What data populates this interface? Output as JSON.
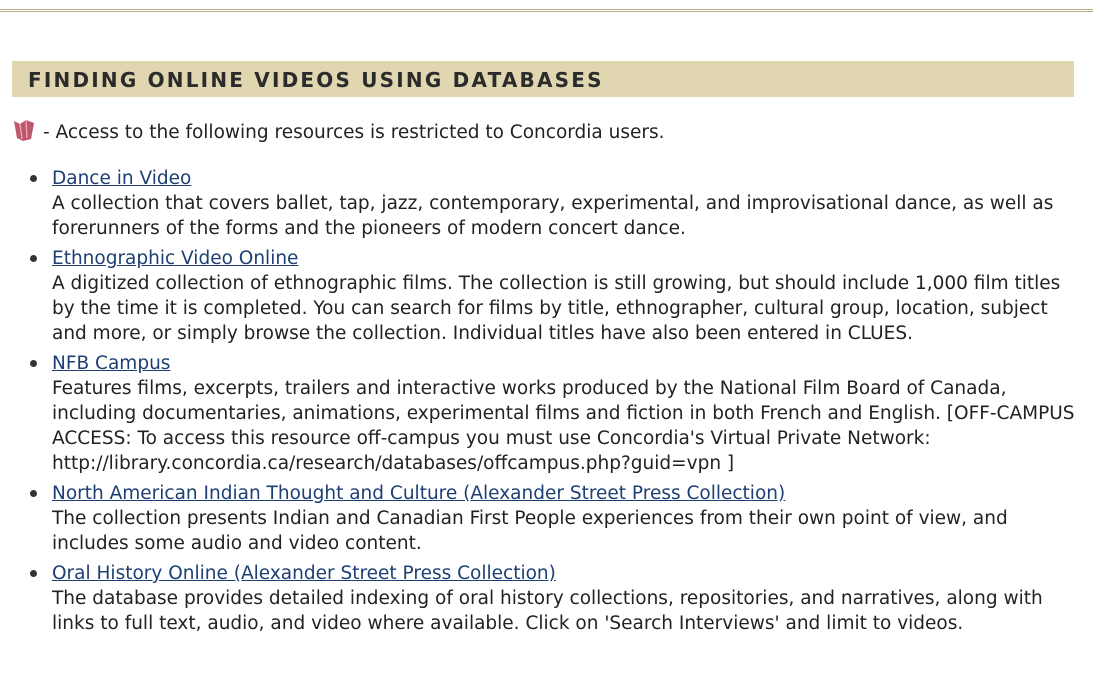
{
  "section": {
    "title": "FINDING ONLINE VIDEOS USING DATABASES"
  },
  "restricted_note": {
    "icon": "restricted-access-icon",
    "text": "- Access to the following resources is restricted to Concordia users."
  },
  "resources": [
    {
      "title": "Dance in Video",
      "description": "A collection that covers ballet, tap, jazz, contemporary, experimental, and improvisational dance, as well as forerunners of the forms and the pioneers of modern concert dance."
    },
    {
      "title": "Ethnographic Video Online",
      "description": "A digitized collection of ethnographic films. The collection is still growing, but should include 1,000 film titles by the time it is completed. You can search for films by title, ethnographer, cultural group, location, subject and more, or simply browse the collection. Individual titles have also been entered in CLUES."
    },
    {
      "title": "NFB Campus",
      "description": "Features films, excerpts, trailers and interactive works produced by the National Film Board of Canada, including documentaries, animations, experimental films and fiction in both French and English. [OFF-CAMPUS ACCESS: To access this resource off-campus you must use Concordia's Virtual Private Network: http://library.concordia.ca/research/databases/offcampus.php?guid=vpn ]"
    },
    {
      "title": "North American Indian Thought and Culture (Alexander Street Press Collection)",
      "description": "The collection presents Indian and Canadian First People experiences from their own point of view, and includes some audio and video content."
    },
    {
      "title": "Oral History Online (Alexander Street Press Collection)",
      "description": "The database provides detailed indexing of oral history collections, repositories, and narratives, along with links to full text, audio, and video where available. Click on 'Search Interviews' and limit to videos."
    }
  ],
  "colors": {
    "header_background": "#e0d6b0",
    "link": "#1d3f73",
    "restricted_icon": "#c0566c"
  }
}
